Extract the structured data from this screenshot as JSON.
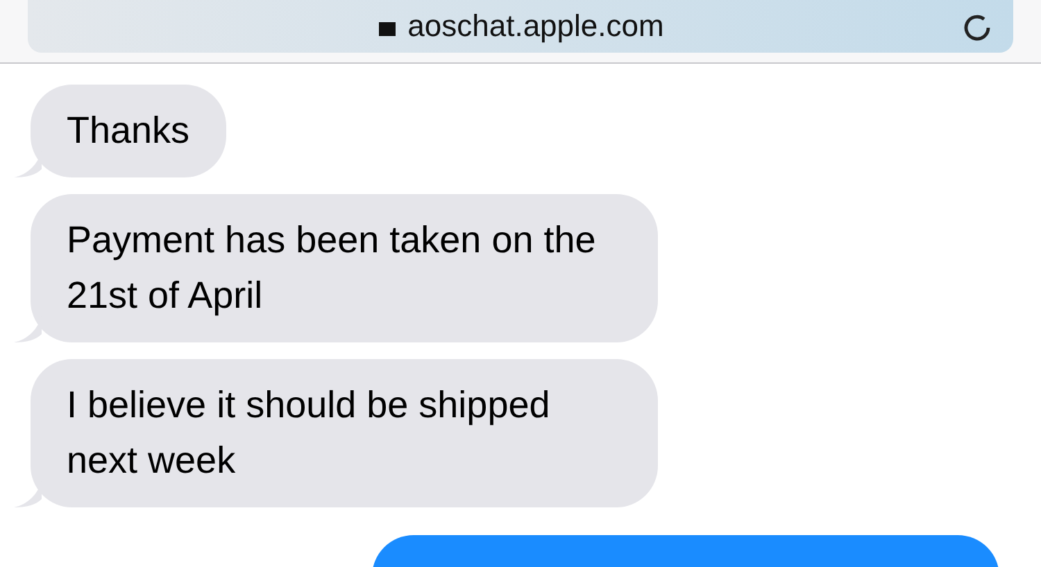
{
  "address_bar": {
    "url": "aoschat.apple.com"
  },
  "messages": [
    {
      "text": "Thanks",
      "kind": "incoming"
    },
    {
      "text": "Payment has been taken on the 21st of April",
      "kind": "incoming"
    },
    {
      "text": "I believe it should be shipped next week",
      "kind": "incoming"
    },
    {
      "kind": "outgoing"
    }
  ]
}
